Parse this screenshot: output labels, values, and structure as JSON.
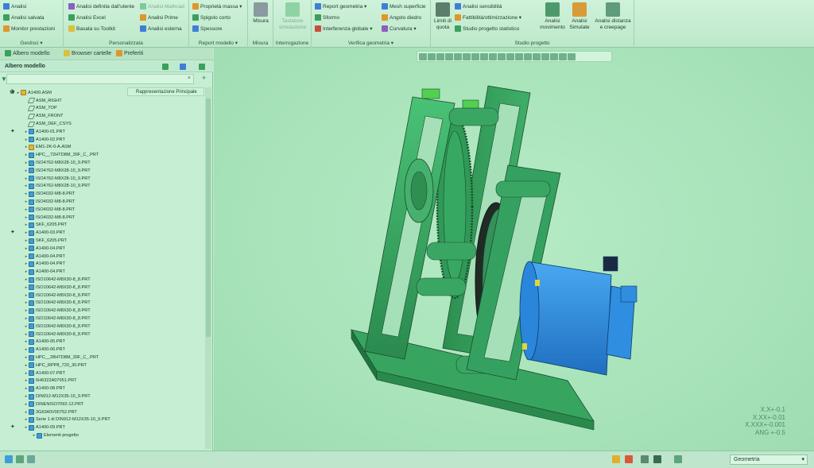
{
  "ribbon": {
    "gestisci": {
      "items": [
        "Analisi",
        "Analisi salvata",
        "Monitor prestazioni"
      ],
      "label": "Gestisci ▾"
    },
    "personalizzata": {
      "items": [
        "Analisi definita dall'utente",
        "Analisi Excel",
        "Basata su Toolkit",
        "Analisi Mathcad",
        "Analisi Prime",
        "Analisi esterna"
      ],
      "label": "Personalizzata"
    },
    "report_modello": {
      "items": [
        "Proprietà massa ▾",
        "Spigolo corto",
        "Spessore"
      ],
      "label": "Report modello ▾"
    },
    "misura": {
      "big": "Misura",
      "label": "Misura"
    },
    "interrogazione": {
      "big": "Tastatore simulazione",
      "label": "Interrogazione"
    },
    "verifica_geometria": {
      "items": [
        "Report geometria ▾",
        "Sformo",
        "Interferenza globale ▾",
        "Mesh superficie",
        "Angolo diedro",
        "Curvatura ▾"
      ],
      "label": "Verifica geometria ▾"
    },
    "studio_progetto": {
      "limiti": "Limiti di quota",
      "items": [
        "Analisi sensibilità",
        "Fattibilità/ottimizzazione ▾",
        "Studio progetto statistico"
      ],
      "bigs": [
        "Analisi movimento",
        "Analisi Simulate",
        "Analisi distanza e creepage"
      ],
      "label": "Studio progetto"
    }
  },
  "left_panel": {
    "tabs": [
      "Albero modello",
      "Browser cartelle",
      "Preferiti"
    ],
    "tree_header": "Albero modello",
    "column_header": "Rappresentazione Principale",
    "rows": [
      {
        "label": "A1400.ASM",
        "type": "asm",
        "level": 0,
        "plus": true
      },
      {
        "label": "ASM_RIGHT",
        "type": "plane",
        "level": 1
      },
      {
        "label": "ASM_TOP",
        "type": "plane",
        "level": 1
      },
      {
        "label": "ASM_FRONT",
        "type": "plane",
        "level": 1
      },
      {
        "label": "ASM_DEF_CSYS",
        "type": "plane",
        "level": 1
      },
      {
        "label": "A1400-01.PRT",
        "type": "prt",
        "level": 1,
        "plus": true
      },
      {
        "label": "A1400-02.PRT",
        "type": "prt",
        "level": 1
      },
      {
        "label": "EM1-2K-0-A.ASM",
        "type": "asm",
        "level": 1
      },
      {
        "label": "HPC__72HTD8M_30F_C_.PRT",
        "type": "prt",
        "level": 1
      },
      {
        "label": "ISO4762-M8X28-10_9.PRT",
        "type": "prt",
        "level": 1
      },
      {
        "label": "ISO4762-M8X28-10_9.PRT",
        "type": "prt",
        "level": 1
      },
      {
        "label": "ISO4762-M8X28-10_9.PRT",
        "type": "prt",
        "level": 1
      },
      {
        "label": "ISO4762-M8X28-10_9.PRT",
        "type": "prt",
        "level": 1
      },
      {
        "label": "ISO4032-M8-8.PRT",
        "type": "prt",
        "level": 1
      },
      {
        "label": "ISO4032-M8-8.PRT",
        "type": "prt",
        "level": 1
      },
      {
        "label": "ISO4032-M8-8.PRT",
        "type": "prt",
        "level": 1
      },
      {
        "label": "ISO4032-M8-8.PRT",
        "type": "prt",
        "level": 1
      },
      {
        "label": "SKF_6205.PRT",
        "type": "prt",
        "level": 1
      },
      {
        "label": "A1400-03.PRT",
        "type": "prt",
        "level": 1,
        "plus": true
      },
      {
        "label": "SKF_6205.PRT",
        "type": "prt",
        "level": 1
      },
      {
        "label": "A1400-04.PRT",
        "type": "prt",
        "level": 1
      },
      {
        "label": "A1400-04.PRT",
        "type": "prt",
        "level": 1
      },
      {
        "label": "A1400-04.PRT",
        "type": "prt",
        "level": 1
      },
      {
        "label": "A1400-04.PRT",
        "type": "prt",
        "level": 1
      },
      {
        "label": "ISO10642-M8X30-8_8.PRT",
        "type": "prt",
        "level": 1
      },
      {
        "label": "ISO10642-M8X30-8_8.PRT",
        "type": "prt",
        "level": 1
      },
      {
        "label": "ISO10642-M8X30-8_8.PRT",
        "type": "prt",
        "level": 1
      },
      {
        "label": "ISO10642-M8X30-8_8.PRT",
        "type": "prt",
        "level": 1
      },
      {
        "label": "ISO10642-M8X30-8_8.PRT",
        "type": "prt",
        "level": 1
      },
      {
        "label": "ISO10642-M8X30-8_8.PRT",
        "type": "prt",
        "level": 1
      },
      {
        "label": "ISO10642-M8X30-8_8.PRT",
        "type": "prt",
        "level": 1
      },
      {
        "label": "ISO10642-M8X30-8_8.PRT",
        "type": "prt",
        "level": 1
      },
      {
        "label": "A1400-05.PRT",
        "type": "prt",
        "level": 1
      },
      {
        "label": "A1400-06.PRT",
        "type": "prt",
        "level": 1
      },
      {
        "label": "HPC__28HTD8M_30F_C_.PRT",
        "type": "prt",
        "level": 1
      },
      {
        "label": "HPC_RPP8_720_30.PRT",
        "type": "prt",
        "level": 1
      },
      {
        "label": "A1400-07.PRT",
        "type": "prt",
        "level": 1
      },
      {
        "label": "6H6322A07051.PRT",
        "type": "prt",
        "level": 1
      },
      {
        "label": "A1400-08.PRT",
        "type": "prt",
        "level": 1
      },
      {
        "label": "DIN912-M12X35-10_9.PRT",
        "type": "prt",
        "level": 1
      },
      {
        "label": "DINENISO7092-12.PRT",
        "type": "prt",
        "level": 1
      },
      {
        "label": "3G6340V00752.PRT",
        "type": "prt",
        "level": 1
      },
      {
        "label": "Serie 1 di DIN912-M12X35-10_9.PRT",
        "type": "prt",
        "level": 1
      },
      {
        "label": "A1400-09.PRT",
        "type": "prt",
        "level": 1,
        "plus": true
      },
      {
        "label": "Elementi progetto",
        "type": "prt",
        "level": 2
      }
    ]
  },
  "viewport": {
    "tolerances": [
      "X.X+-0.1",
      "X.XX+-0.01",
      "X.XXX+-0.001",
      "ANG +-0.5"
    ]
  },
  "status": {
    "filter_value": "Geometria"
  },
  "colors": {
    "frame_green": "#3aa060",
    "motor_blue": "#2f8ee0"
  }
}
